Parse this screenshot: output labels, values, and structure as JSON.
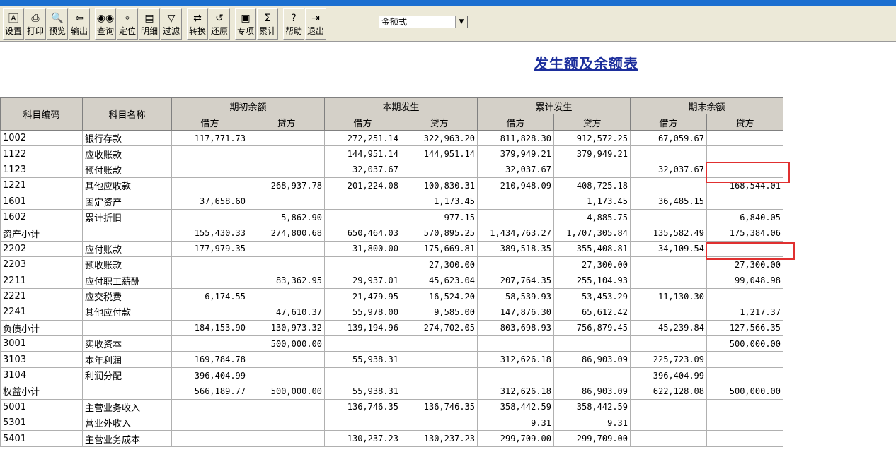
{
  "toolbar": {
    "buttons": [
      {
        "label": "设置",
        "icon": "settings-icon"
      },
      {
        "label": "打印",
        "icon": "printer-icon"
      },
      {
        "label": "预览",
        "icon": "preview-icon"
      },
      {
        "label": "输出",
        "icon": "export-icon"
      },
      {
        "label": "查询",
        "icon": "binoculars-icon"
      },
      {
        "label": "定位",
        "icon": "locate-icon"
      },
      {
        "label": "明细",
        "icon": "detail-icon"
      },
      {
        "label": "过滤",
        "icon": "filter-icon"
      },
      {
        "label": "转换",
        "icon": "convert-icon"
      },
      {
        "label": "还原",
        "icon": "restore-icon"
      },
      {
        "label": "专项",
        "icon": "special-icon"
      },
      {
        "label": "累计",
        "icon": "sigma-icon"
      },
      {
        "label": "帮助",
        "icon": "help-icon"
      },
      {
        "label": "退出",
        "icon": "exit-icon"
      }
    ],
    "format_select": "金额式"
  },
  "report": {
    "title": "发生额及余额表",
    "headers": {
      "code": "科目编码",
      "name": "科目名称",
      "groups": [
        "期初余额",
        "本期发生",
        "累计发生",
        "期末余额"
      ],
      "debit": "借方",
      "credit": "贷方"
    },
    "rows": [
      {
        "code": "1002",
        "name": "银行存款",
        "c": [
          "117,771.73",
          "",
          "272,251.14",
          "322,963.20",
          "811,828.30",
          "912,572.25",
          "67,059.67",
          ""
        ]
      },
      {
        "code": "1122",
        "name": "应收账款",
        "c": [
          "",
          "",
          "144,951.14",
          "144,951.14",
          "379,949.21",
          "379,949.21",
          "",
          ""
        ]
      },
      {
        "code": "1123",
        "name": "预付账款",
        "c": [
          "",
          "",
          "32,037.67",
          "",
          "32,037.67",
          "",
          "32,037.67",
          ""
        ]
      },
      {
        "code": "1221",
        "name": "其他应收款",
        "c": [
          "",
          "268,937.78",
          "201,224.08",
          "100,830.31",
          "210,948.09",
          "408,725.18",
          "",
          "168,544.01"
        ]
      },
      {
        "code": "1601",
        "name": "固定资产",
        "c": [
          "37,658.60",
          "",
          "",
          "1,173.45",
          "",
          "1,173.45",
          "36,485.15",
          ""
        ]
      },
      {
        "code": "1602",
        "name": "累计折旧",
        "c": [
          "",
          "5,862.90",
          "",
          "977.15",
          "",
          "4,885.75",
          "",
          "6,840.05"
        ]
      },
      {
        "code": "资产小计",
        "name": "",
        "c": [
          "155,430.33",
          "274,800.68",
          "650,464.03",
          "570,895.25",
          "1,434,763.27",
          "1,707,305.84",
          "135,582.49",
          "175,384.06"
        ]
      },
      {
        "code": "2202",
        "name": "应付账款",
        "c": [
          "177,979.35",
          "",
          "31,800.00",
          "175,669.81",
          "389,518.35",
          "355,408.81",
          "34,109.54",
          ""
        ]
      },
      {
        "code": "2203",
        "name": "预收账款",
        "c": [
          "",
          "",
          "",
          "27,300.00",
          "",
          "27,300.00",
          "",
          "27,300.00"
        ]
      },
      {
        "code": "2211",
        "name": "应付职工薪酬",
        "c": [
          "",
          "83,362.95",
          "29,937.01",
          "45,623.04",
          "207,764.35",
          "255,104.93",
          "",
          "99,048.98"
        ]
      },
      {
        "code": "2221",
        "name": "应交税费",
        "c": [
          "6,174.55",
          "",
          "21,479.95",
          "16,524.20",
          "58,539.93",
          "53,453.29",
          "11,130.30",
          ""
        ]
      },
      {
        "code": "2241",
        "name": "其他应付款",
        "c": [
          "",
          "47,610.37",
          "55,978.00",
          "9,585.00",
          "147,876.30",
          "65,612.42",
          "",
          "1,217.37"
        ]
      },
      {
        "code": "负债小计",
        "name": "",
        "c": [
          "184,153.90",
          "130,973.32",
          "139,194.96",
          "274,702.05",
          "803,698.93",
          "756,879.45",
          "45,239.84",
          "127,566.35"
        ]
      },
      {
        "code": "3001",
        "name": "实收资本",
        "c": [
          "",
          "500,000.00",
          "",
          "",
          "",
          "",
          "",
          "500,000.00"
        ]
      },
      {
        "code": "3103",
        "name": "本年利润",
        "c": [
          "169,784.78",
          "",
          "55,938.31",
          "",
          "312,626.18",
          "86,903.09",
          "225,723.09",
          ""
        ]
      },
      {
        "code": "3104",
        "name": "利润分配",
        "c": [
          "396,404.99",
          "",
          "",
          "",
          "",
          "",
          "396,404.99",
          ""
        ]
      },
      {
        "code": "权益小计",
        "name": "",
        "c": [
          "566,189.77",
          "500,000.00",
          "55,938.31",
          "",
          "312,626.18",
          "86,903.09",
          "622,128.08",
          "500,000.00"
        ]
      },
      {
        "code": "5001",
        "name": "主营业务收入",
        "c": [
          "",
          "",
          "136,746.35",
          "136,746.35",
          "358,442.59",
          "358,442.59",
          "",
          ""
        ]
      },
      {
        "code": "5301",
        "name": "营业外收入",
        "c": [
          "",
          "",
          "",
          "",
          "9.31",
          "9.31",
          "",
          ""
        ]
      },
      {
        "code": "5401",
        "name": "主营业务成本",
        "c": [
          "",
          "",
          "130,237.23",
          "130,237.23",
          "299,709.00",
          "299,709.00",
          "",
          ""
        ]
      }
    ]
  },
  "colors": {
    "title": "#1c2e9c",
    "highlight": "#e03030",
    "header_bg": "#d4d0c8"
  }
}
